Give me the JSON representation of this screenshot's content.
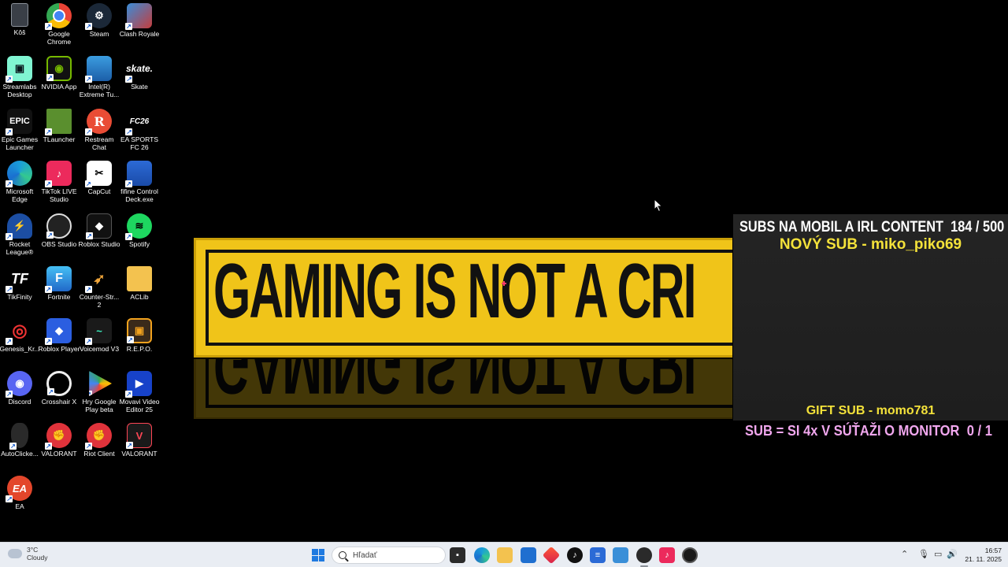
{
  "desktop": {
    "icons": [
      {
        "label": "Kôš",
        "icon": "recycle-bin-icon"
      },
      {
        "label": "Google Chrome",
        "icon": "chrome-icon"
      },
      {
        "label": "Steam",
        "icon": "steam-icon"
      },
      {
        "label": "Clash Royale",
        "icon": "clash-royale-icon"
      },
      {
        "label": "Streamlabs Desktop",
        "icon": "streamlabs-icon"
      },
      {
        "label": "NVIDIA App",
        "icon": "nvidia-icon"
      },
      {
        "label": "Intel(R) Extreme Tu...",
        "icon": "intel-icon"
      },
      {
        "label": "Skate",
        "icon": "skate-icon"
      },
      {
        "label": "Epic Games Launcher",
        "icon": "epic-games-icon"
      },
      {
        "label": "TLauncher",
        "icon": "tlauncher-icon"
      },
      {
        "label": "Restream Chat",
        "icon": "restream-icon"
      },
      {
        "label": "EA SPORTS FC 26",
        "icon": "ea-sports-fc-icon"
      },
      {
        "label": "Microsoft Edge",
        "icon": "edge-icon"
      },
      {
        "label": "TikTok LIVE Studio",
        "icon": "tiktok-icon"
      },
      {
        "label": "CapCut",
        "icon": "capcut-icon"
      },
      {
        "label": "fifine Control Deck.exe",
        "icon": "fifine-icon"
      },
      {
        "label": "Rocket League®",
        "icon": "rocket-league-icon"
      },
      {
        "label": "OBS Studio",
        "icon": "obs-icon"
      },
      {
        "label": "Roblox Studio",
        "icon": "roblox-studio-icon"
      },
      {
        "label": "Spotify",
        "icon": "spotify-icon"
      },
      {
        "label": "TikFinity",
        "icon": "tikfinity-icon"
      },
      {
        "label": "Fortnite",
        "icon": "fortnite-icon"
      },
      {
        "label": "Counter-Str... 2",
        "icon": "counter-strike-icon"
      },
      {
        "label": "ACLib",
        "icon": "folder-icon"
      },
      {
        "label": "Genesis_Kr...",
        "icon": "genesis-icon"
      },
      {
        "label": "Roblox Player",
        "icon": "roblox-player-icon"
      },
      {
        "label": "Voicemod V3",
        "icon": "voicemod-icon"
      },
      {
        "label": "R.E.P.O.",
        "icon": "repo-icon"
      },
      {
        "label": "Discord",
        "icon": "discord-icon"
      },
      {
        "label": "Crosshair X",
        "icon": "crosshair-icon"
      },
      {
        "label": "Hry Google Play beta",
        "icon": "google-play-icon"
      },
      {
        "label": "Movavi Video Editor 25",
        "icon": "movavi-icon"
      },
      {
        "label": "AutoClicke...",
        "icon": "mouse-icon"
      },
      {
        "label": "VALORANT",
        "icon": "riot-valorant-icon"
      },
      {
        "label": "Riot Client",
        "icon": "riot-client-icon"
      },
      {
        "label": "VALORANT",
        "icon": "valorant-icon"
      },
      {
        "label": "EA",
        "icon": "ea-icon"
      }
    ]
  },
  "wallpaper": {
    "banner_text": "GAMING IS NOT A CRI"
  },
  "overlay": {
    "goal_title": "SUBS NA MOBIL A IRL CONTENT",
    "goal_progress": "184 / 500",
    "new_sub": "NOVÝ SUB - miko_piko69",
    "gift_sub": "GIFT SUB - momo781",
    "goal2_title": "SUB = SI 4x V SÚŤAŽI O MONITOR",
    "goal2_progress": "0 / 1"
  },
  "taskbar": {
    "weather_temp": "3°C",
    "weather_desc": "Cloudy",
    "search_placeholder": "Hľadať",
    "time": "16:57",
    "date": "21. 11. 2025"
  },
  "colors": {
    "overlay_yellow": "#f4e23a",
    "overlay_pink": "#f1a7ee",
    "banner_yellow": "#f0c419",
    "taskbar_bg": "#e9edf3"
  }
}
